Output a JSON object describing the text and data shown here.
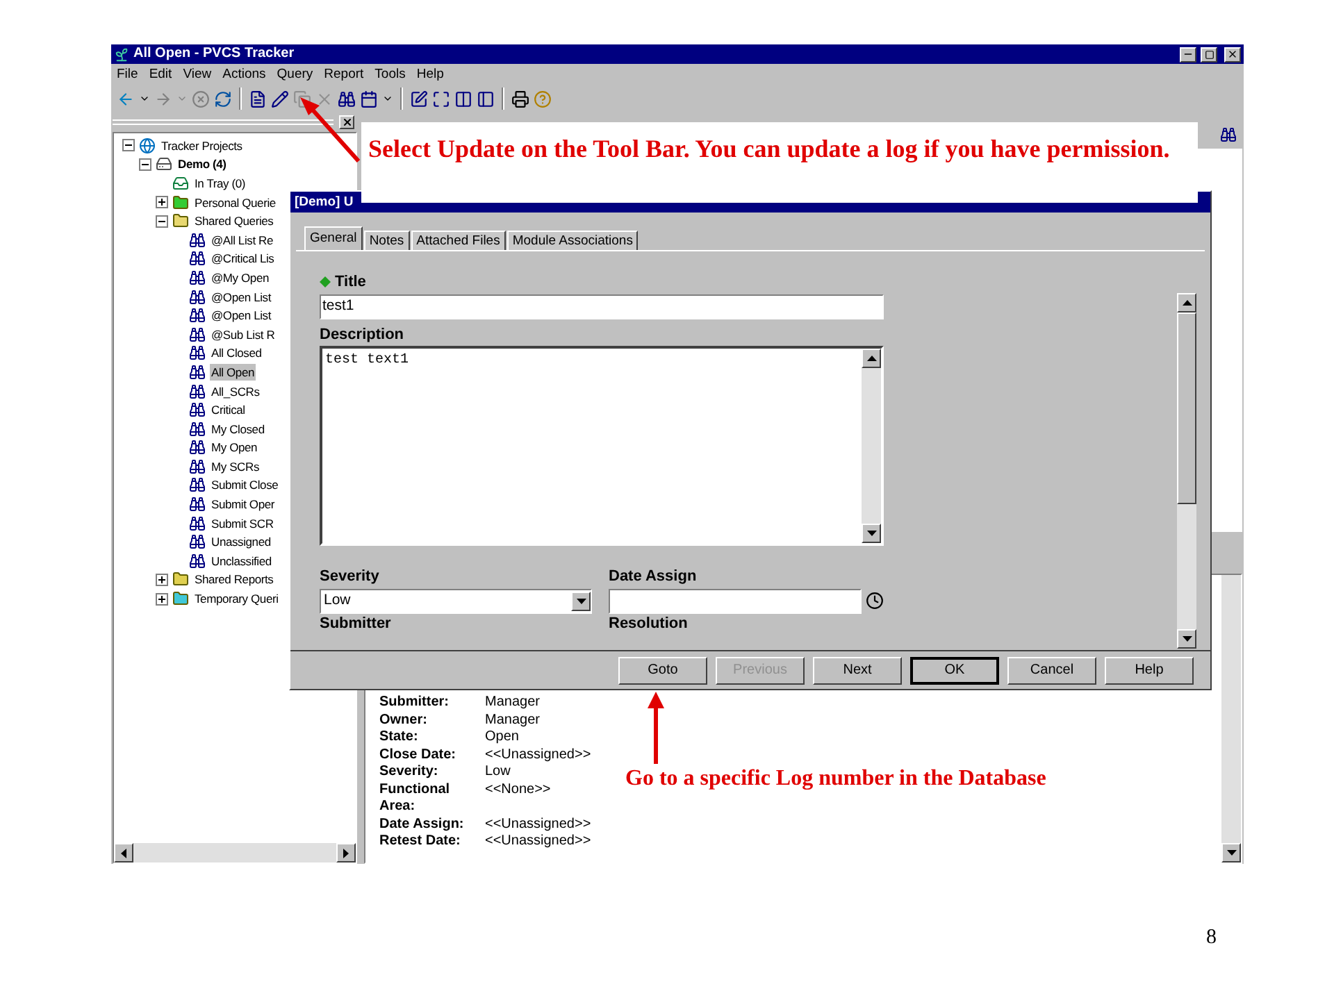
{
  "window": {
    "title": "All Open - PVCS Tracker"
  },
  "menu": [
    "File",
    "Edit",
    "View",
    "Actions",
    "Query",
    "Report",
    "Tools",
    "Help"
  ],
  "tree": [
    {
      "label": "Tracker Projects",
      "kind": "root",
      "expanded": true,
      "selected": false,
      "children": [
        {
          "label": "Demo (4)",
          "kind": "project",
          "expanded": true,
          "selected": false,
          "children": [
            {
              "label": "In Tray (0)",
              "kind": "tray",
              "selected": false
            },
            {
              "label": "Personal Querie",
              "kind": "folder",
              "color": "#33cc33",
              "expanded": false,
              "selected": false
            },
            {
              "label": "Shared Queries",
              "kind": "folder",
              "color": "#e8d870",
              "expanded": true,
              "selected": false,
              "children": [
                {
                  "label": "@All List Re",
                  "kind": "query",
                  "selected": false
                },
                {
                  "label": "@Critical Lis",
                  "kind": "query",
                  "selected": false
                },
                {
                  "label": "@My Open",
                  "kind": "query",
                  "selected": false
                },
                {
                  "label": "@Open List",
                  "kind": "query",
                  "selected": false
                },
                {
                  "label": "@Open List",
                  "kind": "query",
                  "selected": false
                },
                {
                  "label": "@Sub List R",
                  "kind": "query",
                  "selected": false
                },
                {
                  "label": "All Closed",
                  "kind": "query",
                  "selected": false
                },
                {
                  "label": "All Open",
                  "kind": "query",
                  "selected": true
                },
                {
                  "label": "All_SCRs",
                  "kind": "query",
                  "selected": false
                },
                {
                  "label": "Critical",
                  "kind": "query",
                  "selected": false
                },
                {
                  "label": "My Closed",
                  "kind": "query",
                  "selected": false
                },
                {
                  "label": "My Open",
                  "kind": "query",
                  "selected": false
                },
                {
                  "label": "My SCRs",
                  "kind": "query",
                  "selected": false
                },
                {
                  "label": "Submit Close",
                  "kind": "query",
                  "selected": false
                },
                {
                  "label": "Submit Oper",
                  "kind": "query",
                  "selected": false
                },
                {
                  "label": "Submit SCR",
                  "kind": "query",
                  "selected": false
                },
                {
                  "label": "Unassigned",
                  "kind": "query",
                  "selected": false
                },
                {
                  "label": "Unclassified",
                  "kind": "query",
                  "selected": false
                }
              ]
            },
            {
              "label": "Shared Reports",
              "kind": "folder",
              "color": "#e0d050",
              "expanded": false,
              "selected": false
            },
            {
              "label": "Temporary Queri",
              "kind": "folder",
              "color": "#40c8d8",
              "expanded": false,
              "selected": false
            }
          ]
        }
      ]
    }
  ],
  "details": [
    {
      "label": "Submitter:",
      "value": "Manager"
    },
    {
      "label": "Owner:",
      "value": "Manager"
    },
    {
      "label": "State:",
      "value": "Open"
    },
    {
      "label": "Close Date:",
      "value": "<<Unassigned>>"
    },
    {
      "label": "Severity:",
      "value": "Low"
    },
    {
      "label": "Functional Area:",
      "value": "<<None>>"
    },
    {
      "label": "Date Assign:",
      "value": "<<Unassigned>>"
    },
    {
      "label": "Retest Date:",
      "value": "<<Unassigned>>"
    }
  ],
  "dialog": {
    "title": "[Demo] U",
    "tabs": [
      {
        "label": "General",
        "selected": true
      },
      {
        "label": "Notes",
        "selected": false
      },
      {
        "label": "Attached Files",
        "selected": false
      },
      {
        "label": "Module Associations",
        "selected": false
      }
    ],
    "title_label": "Title",
    "title_value": "test1",
    "description_label": "Description",
    "description_value": "test text1",
    "severity_label": "Severity",
    "severity_value": "Low",
    "date_assign_label": "Date Assign",
    "submitter_label": "Submitter",
    "resolution_label": "Resolution",
    "buttons": [
      {
        "label": "Goto",
        "disabled": false,
        "default": false
      },
      {
        "label": "Previous",
        "disabled": true,
        "default": false
      },
      {
        "label": "Next",
        "disabled": false,
        "default": false
      },
      {
        "label": "OK",
        "disabled": false,
        "default": true
      },
      {
        "label": "Cancel",
        "disabled": false,
        "default": false
      },
      {
        "label": "Help",
        "disabled": false,
        "default": false
      }
    ]
  },
  "annotations": [
    {
      "text": "Select Update on the Tool Bar.  You can update a log if you have permission."
    },
    {
      "text": "Go to a specific Log number  in the Database"
    }
  ],
  "page_number": "8"
}
